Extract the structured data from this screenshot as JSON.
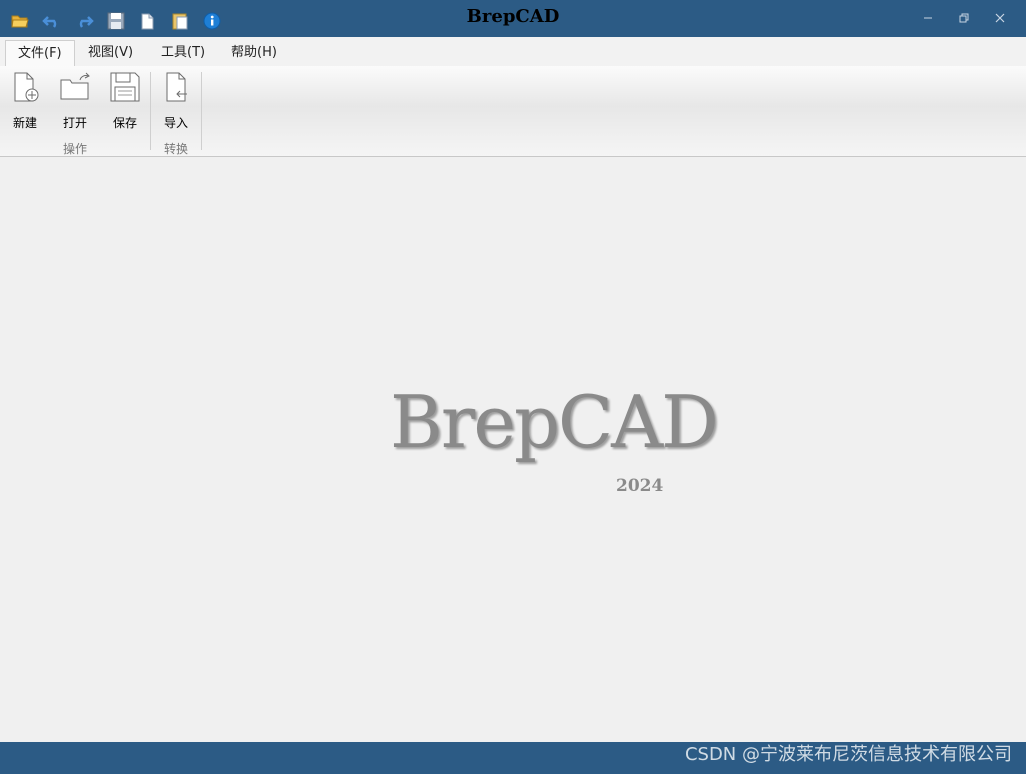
{
  "app": {
    "title": "BrepCAD"
  },
  "quick_access": [
    {
      "name": "open-folder-icon"
    },
    {
      "name": "undo-icon"
    },
    {
      "name": "redo-icon"
    },
    {
      "name": "save-icon"
    },
    {
      "name": "copy-icon"
    },
    {
      "name": "paste-icon"
    },
    {
      "name": "info-icon"
    }
  ],
  "window_controls": {
    "minimize": "minimize-icon",
    "restore": "restore-icon",
    "close": "close-icon"
  },
  "menu_tabs": [
    {
      "label": "文件(F)",
      "active": true
    },
    {
      "label": "视图(V)",
      "active": false
    },
    {
      "label": "工具(T)",
      "active": false
    },
    {
      "label": "帮助(H)",
      "active": false
    }
  ],
  "ribbon": {
    "groups": [
      {
        "label": "操作",
        "buttons": [
          {
            "label": "新建",
            "icon": "new-file-icon"
          },
          {
            "label": "打开",
            "icon": "open-folder-icon"
          },
          {
            "label": "保存",
            "icon": "save-disk-icon"
          }
        ]
      },
      {
        "label": "转换",
        "buttons": [
          {
            "label": "导入",
            "icon": "import-icon"
          }
        ]
      }
    ]
  },
  "splash": {
    "name": "BrepCAD",
    "year": "2024"
  },
  "status": {
    "watermark": "CSDN @宁波莱布尼茨信息技术有限公司"
  },
  "colors": {
    "titlebar": "#2c5b85",
    "statusbar": "#2c5b85",
    "splash_text": "#8a8a8a"
  }
}
